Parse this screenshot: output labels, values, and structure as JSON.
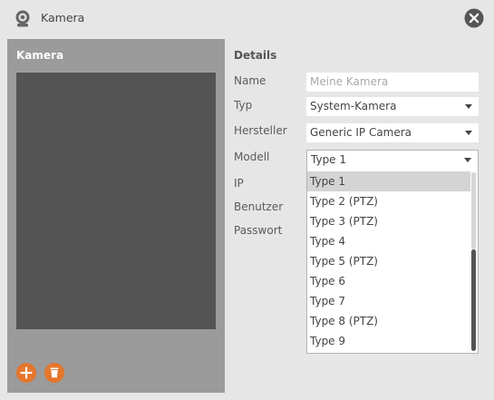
{
  "window": {
    "title": "Kamera",
    "icons": {
      "app": "webcam-icon",
      "close": "close-icon"
    }
  },
  "left_panel": {
    "header": "Kamera",
    "buttons": {
      "add": "plus-icon",
      "delete": "trash-icon"
    },
    "accent_color": "#e4762d"
  },
  "details": {
    "title": "Details",
    "labels": {
      "name": "Name",
      "typ": "Typ",
      "hersteller": "Hersteller",
      "modell": "Modell",
      "ip": "IP",
      "benutzer": "Benutzer",
      "passwort": "Passwort"
    },
    "name_placeholder": "Meine Kamera",
    "typ_value": "System-Kamera",
    "hersteller_value": "Generic IP Camera",
    "modell_value": "Type 1"
  },
  "modell_dropdown": {
    "items": [
      "Type 1",
      "Type 2 (PTZ)",
      "Type 3 (PTZ)",
      "Type 4",
      "Type 5 (PTZ)",
      "Type 6",
      "Type 7",
      "Type 8 (PTZ)",
      "Type 9"
    ],
    "selected": "Type 1"
  }
}
